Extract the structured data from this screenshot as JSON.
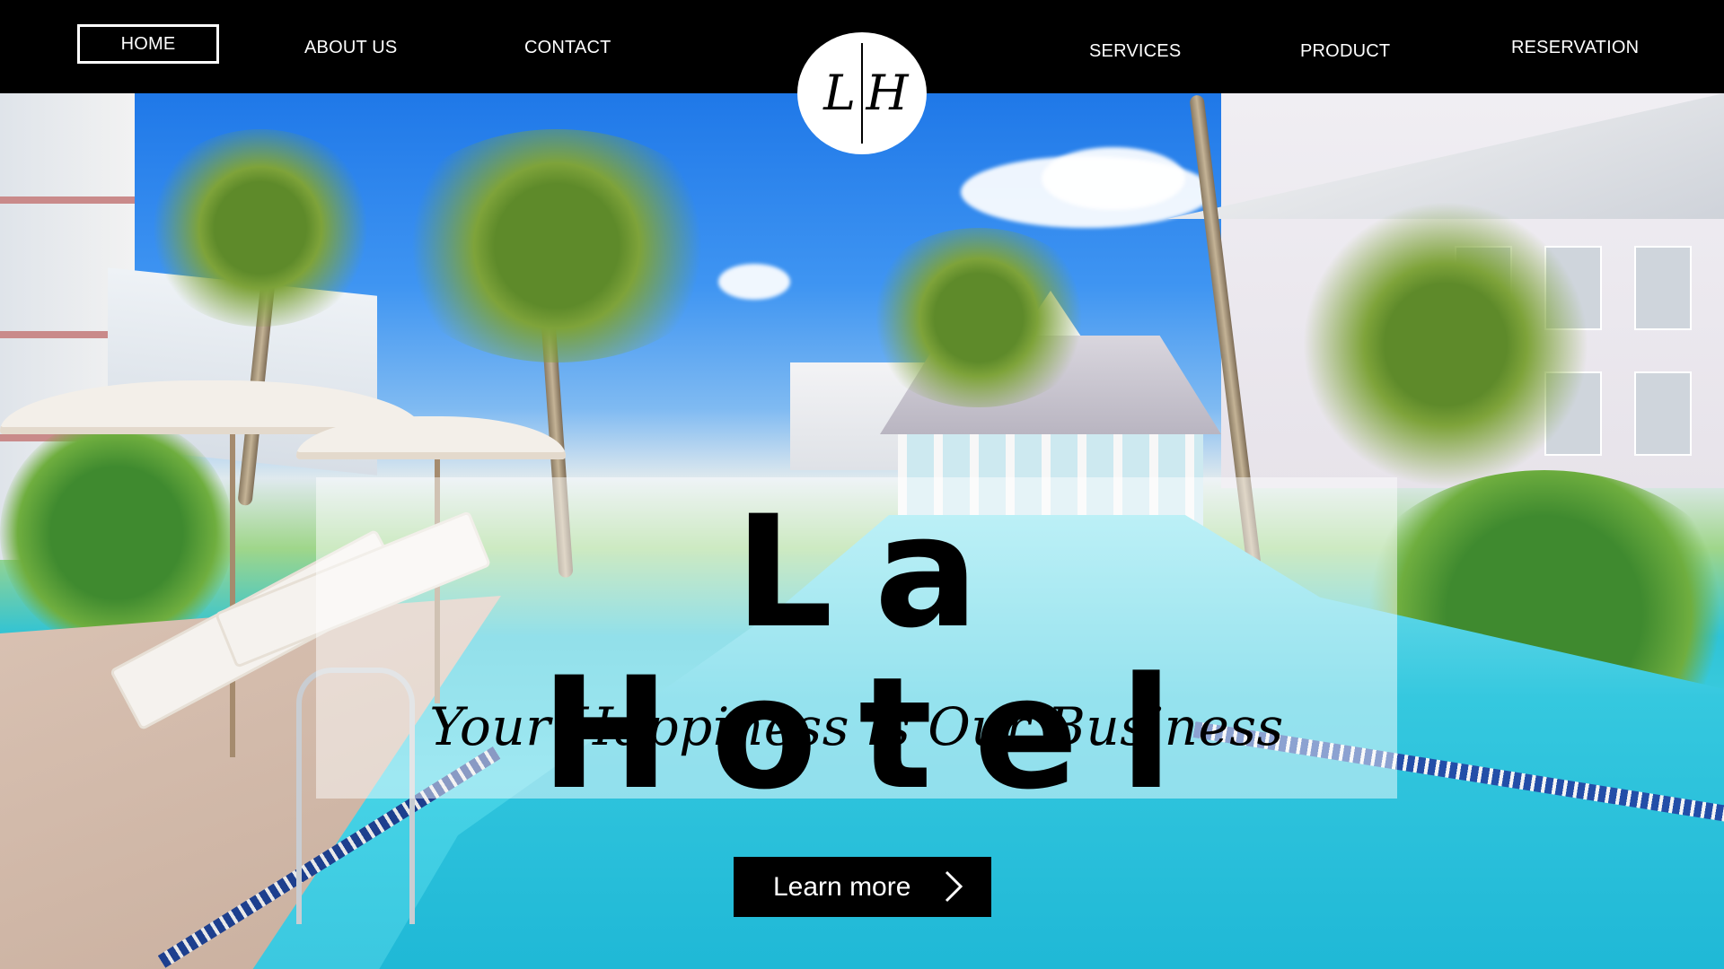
{
  "nav": {
    "home": "HOME",
    "about": "ABOUT US",
    "contact": "CONTACT",
    "services": "SERVICES",
    "product": "PRODUCT",
    "reservation": "RESERVATION",
    "active_item": "HOME"
  },
  "logo": {
    "left_letter": "L",
    "right_letter": "H"
  },
  "hero": {
    "title": "La Hotel",
    "tagline": "Your Happiness is Our Business",
    "cta_label": "Learn more",
    "cta_icon": "chevron-right-icon"
  },
  "colors": {
    "nav_background": "#000000",
    "nav_text": "#ffffff",
    "cta_background": "#000000",
    "panel_overlay": "rgba(255,255,255,0.48)",
    "pool_water": "#35c8df",
    "sky": "#3f95f2"
  }
}
